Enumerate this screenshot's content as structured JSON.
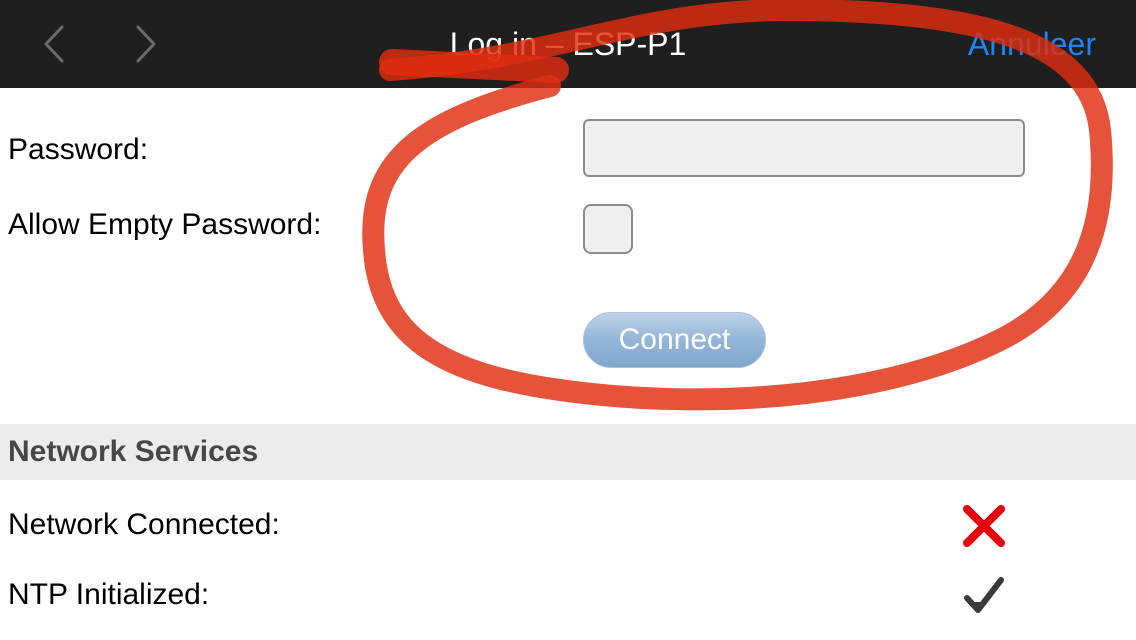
{
  "header": {
    "title": "Log in – ESP-P1",
    "cancel_label": "Annuleer",
    "back_icon": "chevron-left-icon",
    "forward_icon": "chevron-right-icon"
  },
  "login_form": {
    "password_label": "Password:",
    "password_value": "",
    "allow_empty_label": "Allow Empty Password:",
    "allow_empty_checked": false,
    "connect_label": "Connect"
  },
  "network_services": {
    "title": "Network Services",
    "items": [
      {
        "label": "Network Connected:",
        "status": "failed",
        "icon": "cross-icon",
        "color": "#e8000b"
      },
      {
        "label": "NTP Initialized:",
        "status": "ok",
        "icon": "checkmark-icon",
        "color": "#3a3a3a"
      }
    ]
  },
  "colors": {
    "topbar": "#1f1f1f",
    "accent": "#1a86f5",
    "annotation": "#e02d10",
    "section_bg": "#ececec"
  }
}
